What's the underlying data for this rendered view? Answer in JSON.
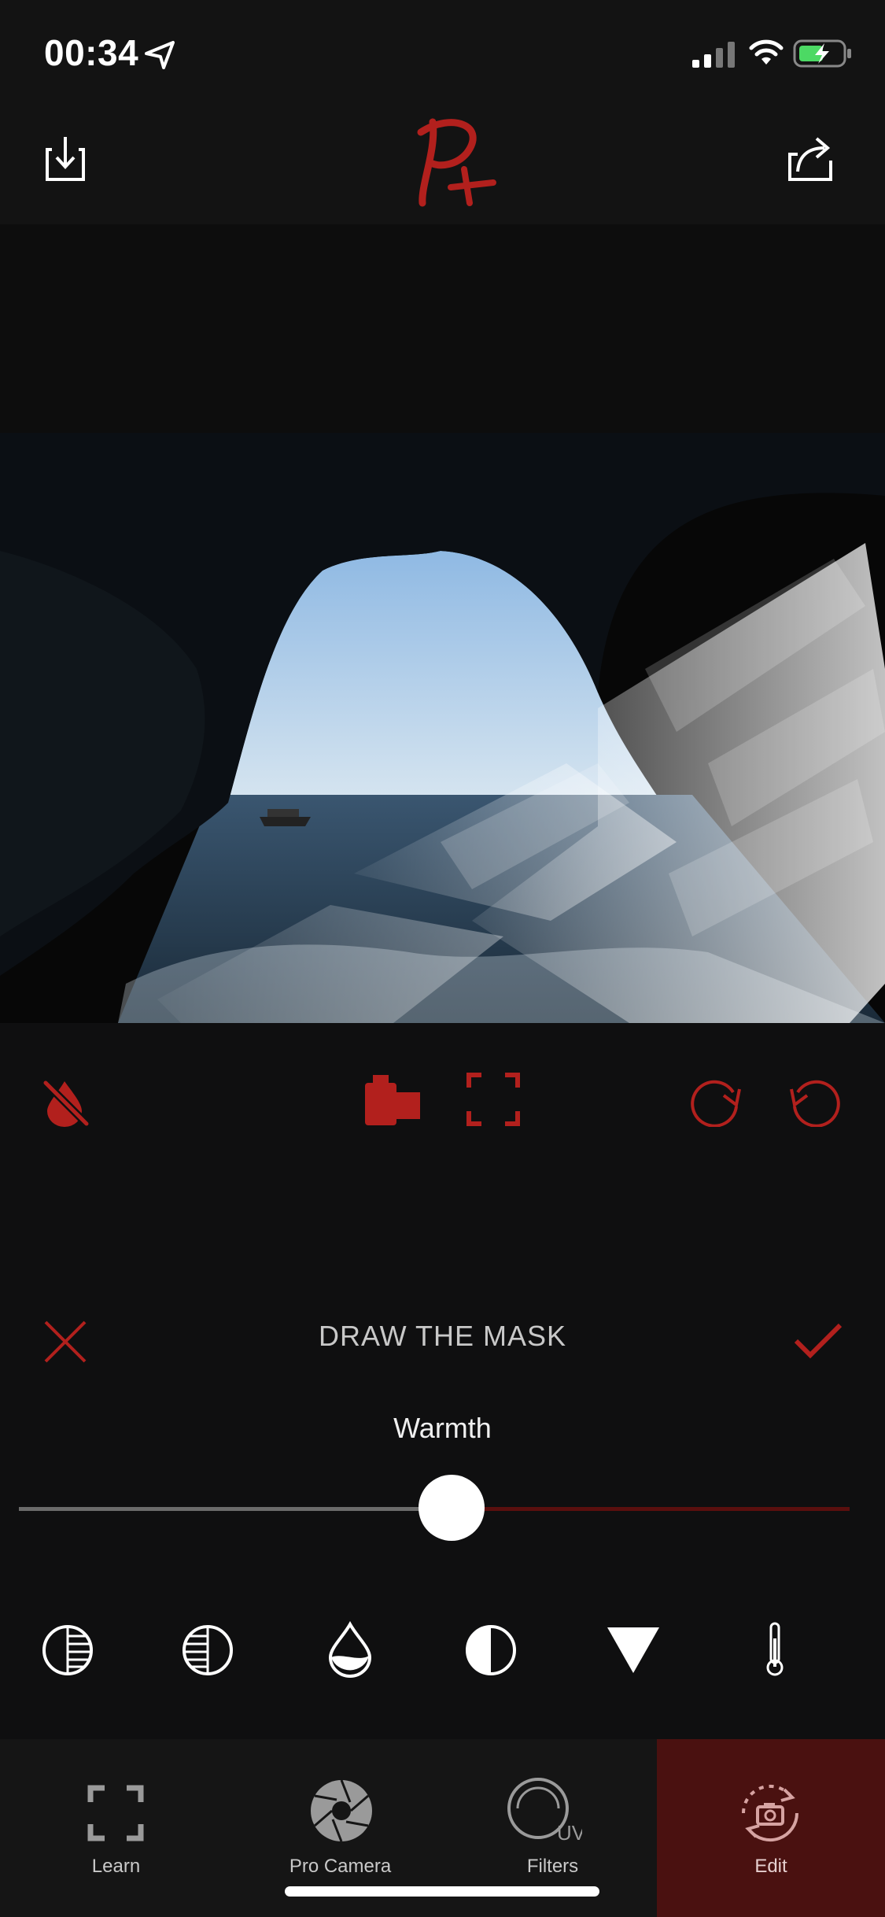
{
  "status_bar": {
    "time": "00:34"
  },
  "header": {
    "logo_text": "P+"
  },
  "edit_panel": {
    "title": "DRAW THE MASK",
    "adjustment_label": "Warmth",
    "slider_value_fraction": 0.51
  },
  "tabs": [
    {
      "label": "Learn",
      "icon": "focus-frame-icon",
      "active": false
    },
    {
      "label": "Pro Camera",
      "icon": "aperture-icon",
      "active": false
    },
    {
      "label": "Filters",
      "icon": "uv-filter-icon",
      "active": false
    },
    {
      "label": "Edit",
      "icon": "camera-rotate-icon",
      "active": true
    }
  ],
  "colors": {
    "accent_red": "#b2201d",
    "active_tab_bg": "#4a1110",
    "background": "#0f0f10"
  }
}
